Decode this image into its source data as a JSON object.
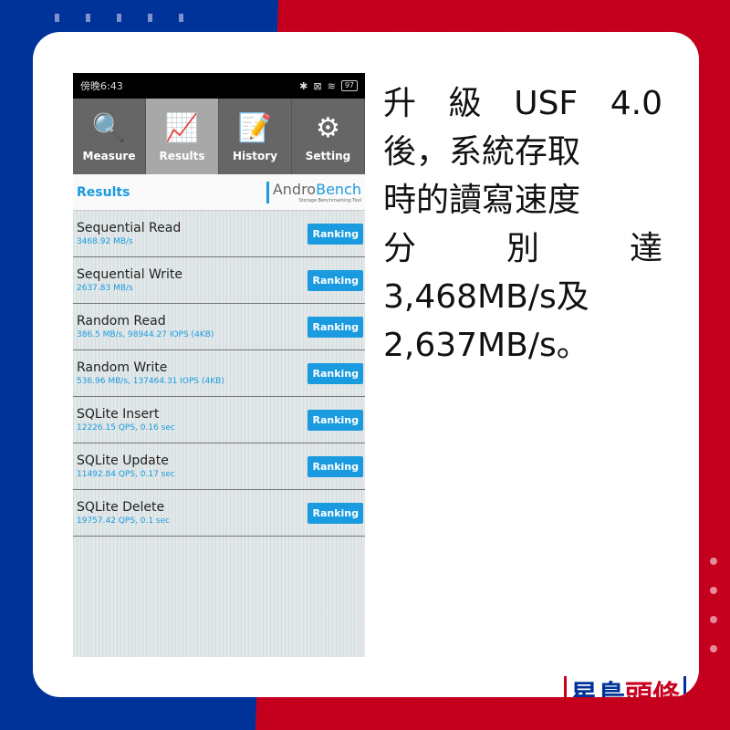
{
  "statusbar": {
    "time": "傍晚6:43",
    "battery": "97"
  },
  "nav": [
    {
      "label": "Measure",
      "icon": "search-icon",
      "glyph": "🔍"
    },
    {
      "label": "Results",
      "icon": "chart-icon",
      "glyph": "📈"
    },
    {
      "label": "History",
      "icon": "document-icon",
      "glyph": "📝"
    },
    {
      "label": "Setting",
      "icon": "gear-icon",
      "glyph": "⚙"
    }
  ],
  "results": {
    "title": "Results",
    "logo_a": "Andro",
    "logo_b": "Bench",
    "logo_sub": "Storage Benchmarking Tool"
  },
  "rows": [
    {
      "name": "Sequential Read",
      "value": "3468.92 MB/s",
      "button": "Ranking"
    },
    {
      "name": "Sequential Write",
      "value": "2637.83 MB/s",
      "button": "Ranking"
    },
    {
      "name": "Random Read",
      "value": "386.5 MB/s, 98944.27 IOPS (4KB)",
      "button": "Ranking"
    },
    {
      "name": "Random Write",
      "value": "536.96 MB/s, 137464.31 IOPS (4KB)",
      "button": "Ranking"
    },
    {
      "name": "SQLite Insert",
      "value": "12226.15 QPS, 0.16 sec",
      "button": "Ranking"
    },
    {
      "name": "SQLite Update",
      "value": "11492.84 QPS, 0.17 sec",
      "button": "Ranking"
    },
    {
      "name": "SQLite Delete",
      "value": "19757.42 QPS, 0.1 sec",
      "button": "Ranking"
    }
  ],
  "headline": [
    "升 級 USF 4.0",
    "後，系統存取",
    "時的讀寫速度",
    "分 別 達",
    "3,468MB/s及",
    "2,637MB/s。"
  ],
  "brand": {
    "part1": "星島",
    "part2": "頭條"
  }
}
